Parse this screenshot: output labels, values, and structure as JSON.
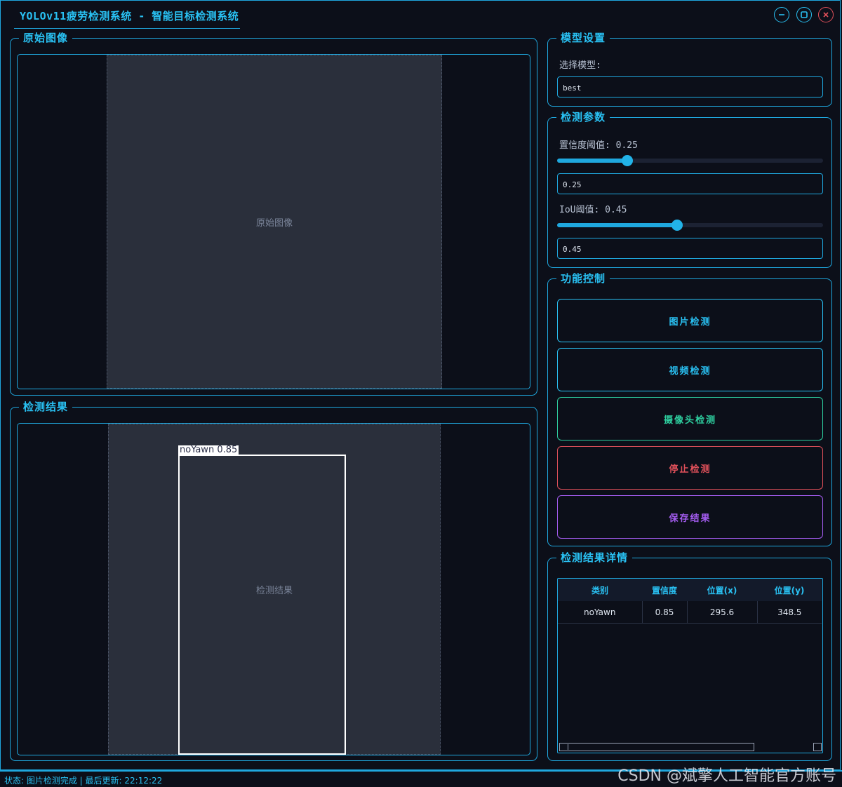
{
  "window": {
    "title": "YOLOv11疲劳检测系统 - 智能目标检测系统",
    "buttons": [
      "minimize",
      "maximize",
      "close"
    ]
  },
  "original_panel": {
    "title": "原始图像",
    "image_alt": "原始图像"
  },
  "result_panel": {
    "title": "检测结果",
    "image_alt": "检测结果",
    "detection_label": "noYawn  0.85"
  },
  "model_settings": {
    "title": "模型设置",
    "select_label": "选择模型:",
    "selected_model": "best"
  },
  "detection_params": {
    "title": "检测参数",
    "confidence_label": "置信度阈值: 0.25",
    "confidence_value": "0.25",
    "confidence_level": 0.25,
    "iou_label": "IoU阈值: 0.45",
    "iou_value": "0.45",
    "iou_level": 0.45
  },
  "function_control": {
    "title": "功能控制",
    "buttons": [
      {
        "label": "图片检测",
        "color": "#29c1f3"
      },
      {
        "label": "视频检测",
        "color": "#29c1f3"
      },
      {
        "label": "摄像头检测",
        "color": "#2ed0a0"
      },
      {
        "label": "停止检测",
        "color": "#e0505a"
      },
      {
        "label": "保存结果",
        "color": "#a45cf0"
      }
    ]
  },
  "details": {
    "title": "检测结果详情",
    "columns": [
      "类别",
      "置信度",
      "位置(x)",
      "位置(y)"
    ],
    "rows": [
      [
        "noYawn",
        "0.85",
        "295.6",
        "348.5"
      ]
    ]
  },
  "status": "状态: 图片检测完成 | 最后更新: 22:12:22",
  "watermark": "CSDN @斌擎人工智能官方账号",
  "colors": {
    "accent": "#1fa8df",
    "background": "#0c0f19",
    "stop": "#e0505a",
    "save": "#a45cf0",
    "camera": "#2ed0a0"
  }
}
